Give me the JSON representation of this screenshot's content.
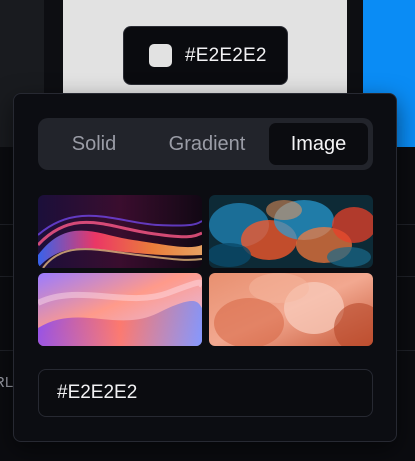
{
  "trigger": {
    "label": "#E2E2E2",
    "swatch_color": "#E2E2E2"
  },
  "background": {
    "partial_text": "RL"
  },
  "picker": {
    "tabs": [
      {
        "label": "Solid",
        "active": false
      },
      {
        "label": "Gradient",
        "active": false
      },
      {
        "label": "Image",
        "active": true
      }
    ],
    "images": [
      {
        "name": "abstract-neon-waves"
      },
      {
        "name": "colorful-smoke-ink"
      },
      {
        "name": "pastel-gradient-waves"
      },
      {
        "name": "peach-soft-shapes"
      }
    ],
    "hex_value": "#E2E2E2"
  },
  "colors": {
    "background": "#0b0c10",
    "panel": "#0c0d12",
    "tab_track": "#22242b",
    "accent_blue": "#0a8cf5"
  }
}
